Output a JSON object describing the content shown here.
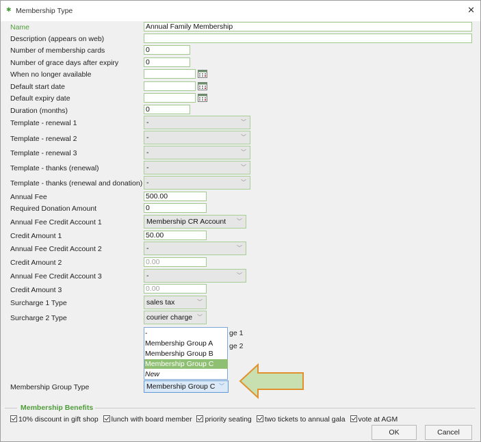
{
  "window": {
    "title": "Membership Type",
    "close_glyph": "✕"
  },
  "fields": {
    "name": {
      "label": "Name",
      "value": "Annual Family Membership"
    },
    "description": {
      "label": "Description (appears on web)",
      "value": ""
    },
    "num_cards": {
      "label": "Number of membership cards",
      "value": "0"
    },
    "grace_days": {
      "label": "Number of grace days after expiry",
      "value": "0"
    },
    "no_longer_available": {
      "label": "When no longer available",
      "value": ""
    },
    "default_start": {
      "label": "Default start date",
      "value": ""
    },
    "default_expiry": {
      "label": "Default expiry date",
      "value": ""
    },
    "duration": {
      "label": "Duration (months)",
      "value": "0"
    },
    "template_renewal_1": {
      "label": "Template - renewal 1",
      "value": "-"
    },
    "template_renewal_2": {
      "label": "Template - renewal 2",
      "value": "-"
    },
    "template_renewal_3": {
      "label": "Template - renewal 3",
      "value": "-"
    },
    "template_thanks_renewal": {
      "label": "Template - thanks (renewal)",
      "value": "-"
    },
    "template_thanks_renewal_donation": {
      "label": "Template - thanks (renewal and donation)",
      "value": "-"
    },
    "annual_fee": {
      "label": "Annual Fee",
      "value": "500.00"
    },
    "required_donation": {
      "label": "Required Donation Amount",
      "value": "0"
    },
    "credit_account_1": {
      "label": "Annual Fee Credit Account 1",
      "value": "Membership CR Account"
    },
    "credit_amount_1": {
      "label": "Credit Amount 1",
      "value": "50.00"
    },
    "credit_account_2": {
      "label": "Annual Fee Credit Account 2",
      "value": "-"
    },
    "credit_amount_2": {
      "label": "Credit Amount 2",
      "value": "0.00"
    },
    "credit_account_3": {
      "label": "Annual Fee Credit Account 3",
      "value": "-"
    },
    "credit_amount_3": {
      "label": "Credit Amount 3",
      "value": "0.00"
    },
    "surcharge_1": {
      "label": "Surcharge 1 Type",
      "value": "sales tax"
    },
    "surcharge_2": {
      "label": "Surcharge 2 Type",
      "value": "courier charge"
    },
    "group_type": {
      "label": "Membership Group Type",
      "value": "Membership Group C"
    }
  },
  "group_dropdown": {
    "options": [
      "-",
      "Membership Group A",
      "Membership Group B",
      "Membership Group C",
      "New"
    ],
    "selected_index": 3
  },
  "hidden_fragments": [
    "ge 1",
    "ge 2"
  ],
  "benefits": {
    "legend": "Membership Benefits",
    "items": [
      "10% discount in gift shop",
      "lunch with board member",
      "priority seating",
      "two tickets to annual gala",
      "vote at AGM"
    ]
  },
  "buttons": {
    "ok": "OK",
    "cancel": "Cancel"
  },
  "colors": {
    "accent_green": "#4f9c3a",
    "arrow_fill": "#c8e0b0",
    "arrow_stroke": "#e0912e",
    "dropdown_selected": "#8fbf72"
  }
}
